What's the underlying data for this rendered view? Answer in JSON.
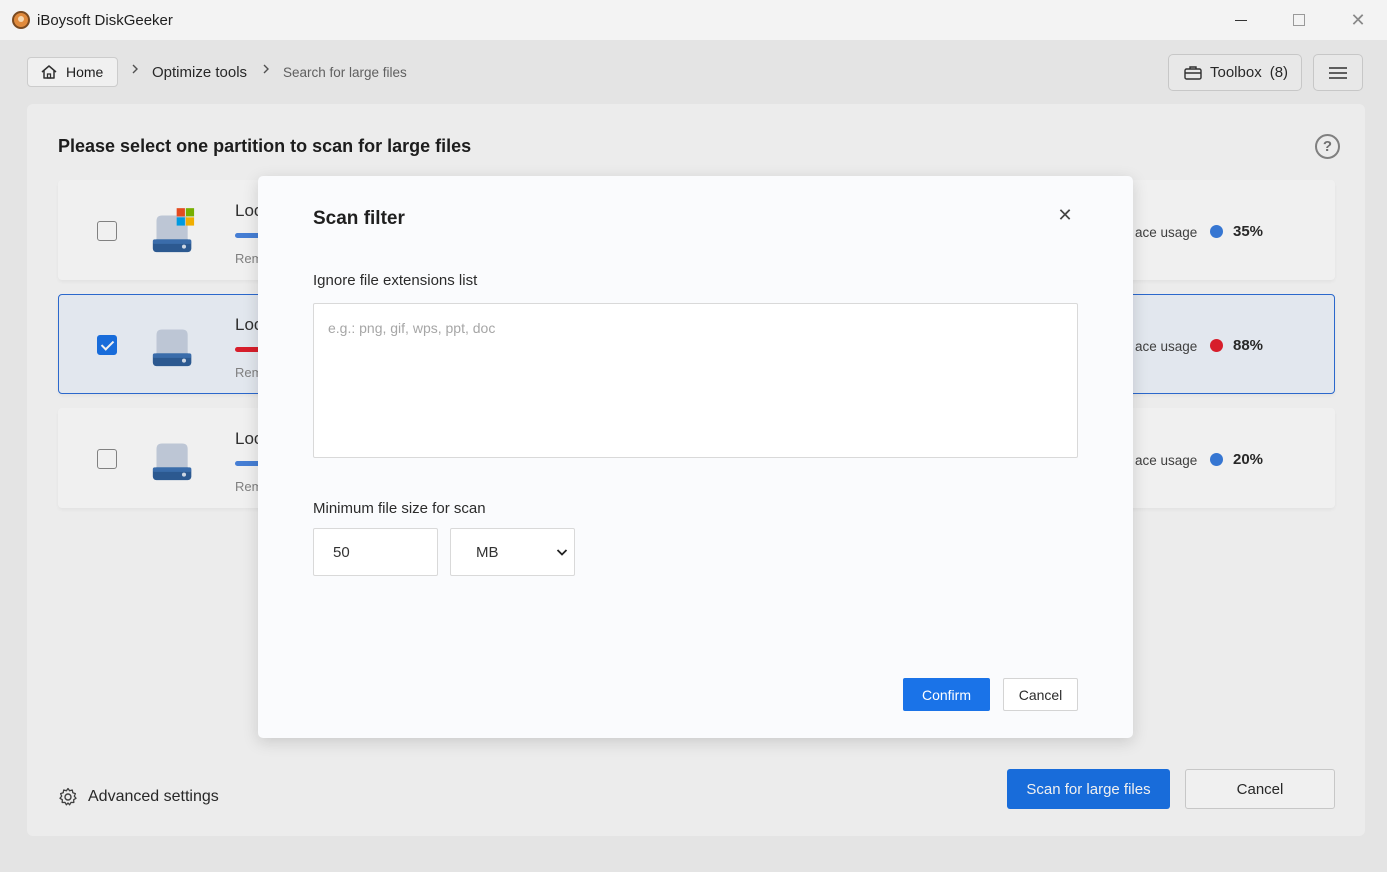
{
  "window": {
    "title": "iBoysoft DiskGeeker"
  },
  "nav": {
    "home_label": "Home",
    "crumb_optimize": "Optimize tools",
    "crumb_current": "Search for large files",
    "toolbox_label": "Toolbox",
    "toolbox_count": "(8)"
  },
  "main": {
    "title": "Please select one partition to scan for large files",
    "usage_label": "ace usage",
    "partitions": [
      {
        "name": "Loc",
        "remaining": "Rem",
        "usage": "35%",
        "dot_color": "#3a7ee0",
        "bar_color": "#4a86e2",
        "checked": false,
        "windows": true
      },
      {
        "name": "Loc",
        "remaining": "Rem",
        "usage": "88%",
        "dot_color": "#e5202e",
        "bar_color": "#e5202e",
        "checked": true,
        "windows": false
      },
      {
        "name": "Loc",
        "remaining": "Rem",
        "usage": "20%",
        "dot_color": "#3a7ee0",
        "bar_color": "#4a86e2",
        "checked": false,
        "windows": false
      }
    ],
    "advanced_settings": "Advanced settings",
    "scan_button": "Scan for large files",
    "cancel_button": "Cancel"
  },
  "dialog": {
    "title": "Scan filter",
    "ignore_label": "Ignore file extensions list",
    "ignore_placeholder": "e.g.: png, gif, wps, ppt, doc",
    "min_size_label": "Minimum file size for scan",
    "min_size_value": "50",
    "unit_value": "MB",
    "confirm": "Confirm",
    "cancel": "Cancel"
  },
  "colors": {
    "accent": "#1a73e8",
    "danger": "#e5202e",
    "info": "#3a7ee0"
  }
}
